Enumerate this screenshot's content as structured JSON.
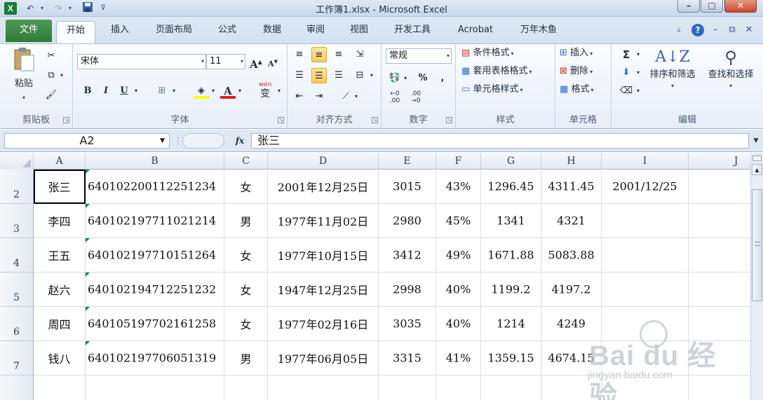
{
  "window": {
    "title": "工作簿1.xlsx - Microsoft Excel",
    "app_icon_text": "X",
    "minimize": "–",
    "restore": "□",
    "close": "✕"
  },
  "quick_access": {
    "undo_icon": "undo-icon",
    "redo_icon": "redo-icon",
    "save_icon": "save-icon"
  },
  "tabs": [
    {
      "label": "文件"
    },
    {
      "label": "开始"
    },
    {
      "label": "插入"
    },
    {
      "label": "页面布局"
    },
    {
      "label": "公式"
    },
    {
      "label": "数据"
    },
    {
      "label": "审阅"
    },
    {
      "label": "视图"
    },
    {
      "label": "开发工具"
    },
    {
      "label": "Acrobat"
    },
    {
      "label": "万年木鱼"
    }
  ],
  "active_tab": "开始",
  "ribbon": {
    "clipboard": {
      "title": "剪贴板",
      "paste": "粘贴"
    },
    "font": {
      "title": "字体",
      "font_name": "宋体",
      "font_size": "11",
      "bold": "B",
      "italic": "I",
      "underline": "U",
      "grow": "A",
      "shrink": "A",
      "font_color_letter": "A",
      "wen": "wén",
      "wen_char": "变"
    },
    "alignment": {
      "title": "对齐方式"
    },
    "number": {
      "title": "数字",
      "format": "常规",
      "percent": "%",
      "comma": ","
    },
    "styles": {
      "title": "样式",
      "conditional": "条件格式",
      "table": "套用表格格式",
      "cell_styles": "单元格样式"
    },
    "cells": {
      "title": "单元格",
      "insert": "插入",
      "delete": "删除",
      "format": "格式"
    },
    "editing": {
      "title": "编辑",
      "sigma": "Σ",
      "sort": "排序和筛选",
      "find": "查找和选择"
    }
  },
  "formula_bar": {
    "name_box": "A2",
    "fx": "fx",
    "content": "张三"
  },
  "columns": [
    "A",
    "B",
    "C",
    "D",
    "E",
    "F",
    "G",
    "H",
    "I",
    "J"
  ],
  "rows": [
    {
      "num": "2",
      "cells": [
        "张三",
        "640102200112251234",
        "女",
        "2001年12月25日",
        "3015",
        "43%",
        "1296.45",
        "4311.45",
        "2001/12/25"
      ]
    },
    {
      "num": "3",
      "cells": [
        "李四",
        "640102197711021214",
        "男",
        "1977年11月02日",
        "2980",
        "45%",
        "1341",
        "4321",
        ""
      ]
    },
    {
      "num": "4",
      "cells": [
        "王五",
        "640102197710151264",
        "女",
        "1977年10月15日",
        "3412",
        "49%",
        "1671.88",
        "5083.88",
        ""
      ]
    },
    {
      "num": "5",
      "cells": [
        "赵六",
        "640102194712251232",
        "女",
        "1947年12月25日",
        "2998",
        "40%",
        "1199.2",
        "4197.2",
        ""
      ]
    },
    {
      "num": "6",
      "cells": [
        "周四",
        "640105197702161258",
        "女",
        "1977年02月16日",
        "3035",
        "40%",
        "1214",
        "4249",
        ""
      ]
    },
    {
      "num": "7",
      "cells": [
        "钱八",
        "640102197706051319",
        "男",
        "1977年06月05日",
        "3315",
        "41%",
        "1359.15",
        "4674.15",
        ""
      ]
    }
  ],
  "watermark": {
    "brand": "Bai du 经验",
    "url": "jingyan.baidu.com"
  },
  "colors": {
    "file_tab": "#2e7c33",
    "selection": "#000000",
    "text_triangle": "#1b8a3a"
  }
}
